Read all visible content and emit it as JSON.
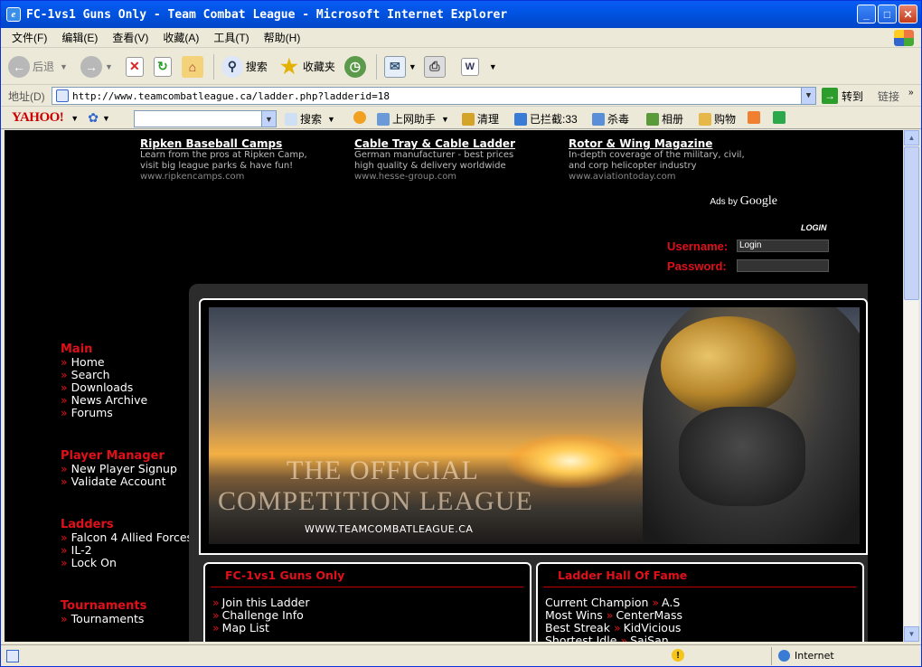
{
  "window": {
    "title": "FC-1vs1 Guns Only - Team Combat League - Microsoft Internet Explorer",
    "min": "_",
    "max": "□",
    "close": "✕"
  },
  "menu": [
    "文件(F)",
    "编辑(E)",
    "查看(V)",
    "收藏(A)",
    "工具(T)",
    "帮助(H)"
  ],
  "toolbar": {
    "back": "后退",
    "search": "搜索",
    "favorites": "收藏夹"
  },
  "address": {
    "label": "地址(D)",
    "url": "http://www.teamcombatleague.ca/ladder.php?ladderid=18",
    "go": "转到",
    "links": "链接"
  },
  "yahoo": {
    "logo": "YAHOO!",
    "search": "搜索",
    "helper": "上网助手",
    "clean": "清理",
    "blocked": "已拦截:33",
    "antivirus": "杀毒",
    "album": "相册",
    "shopping": "购物"
  },
  "ads": [
    {
      "title": "Ripken Baseball Camps",
      "desc1": "Learn from the pros at Ripken Camp,",
      "desc2": "visit big league parks & have fun!",
      "url": "www.ripkencamps.com"
    },
    {
      "title": "Cable Tray & Cable Ladder",
      "desc1": "German manufacturer - best prices",
      "desc2": "high quality & delivery worldwide",
      "url": "www.hesse-group.com"
    },
    {
      "title": "Rotor & Wing Magazine",
      "desc1": "In-depth coverage of the military, civil,",
      "desc2": "and corp helicopter industry",
      "url": "www.aviationtoday.com"
    }
  ],
  "adsby": {
    "prefix": "Ads by",
    "brand": "Google"
  },
  "login": {
    "heading": "LOGIN",
    "username_label": "Username:",
    "username_value": "Login",
    "password_label": "Password:"
  },
  "sidebar": {
    "main": {
      "heading": "Main",
      "items": [
        "Home",
        "Search",
        "Downloads",
        "News Archive",
        "Forums"
      ]
    },
    "player": {
      "heading": "Player Manager",
      "items": [
        "New Player Signup",
        "Validate Account"
      ]
    },
    "ladders": {
      "heading": "Ladders",
      "items": [
        "Falcon 4 Allied Forces",
        "IL-2",
        "Lock On"
      ]
    },
    "tournaments": {
      "heading": "Tournaments",
      "items": [
        "Tournaments"
      ]
    }
  },
  "banner": {
    "line1": "THE OFFICIAL",
    "line2": "COMPETITION LEAGUE",
    "url": "WWW.TEAMCOMBATLEAGUE.CA"
  },
  "ladder_panel": {
    "heading": "FC-1vs1 Guns Only",
    "items": [
      "Join this Ladder",
      "Challenge Info",
      "Map List"
    ]
  },
  "hof_panel": {
    "heading": "Ladder Hall Of Fame",
    "rows": [
      {
        "label": "Current Champion",
        "value": "A.S"
      },
      {
        "label": "Most Wins",
        "value": "CenterMass"
      },
      {
        "label": "Best Streak",
        "value": "KidVicious"
      },
      {
        "label": "Shortest Idle",
        "value": "SaiSan"
      }
    ]
  },
  "status": {
    "zone": "Internet"
  }
}
